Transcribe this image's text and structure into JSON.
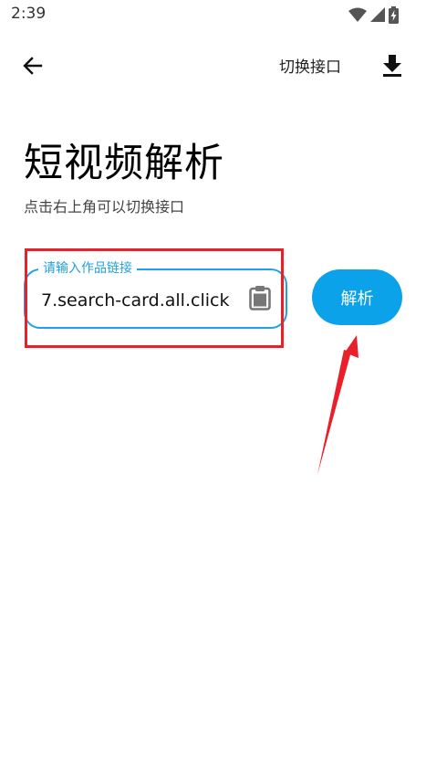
{
  "status_bar": {
    "time": "2:39",
    "icons": [
      "wifi-icon",
      "signal-icon",
      "battery-charging-icon"
    ]
  },
  "app_bar": {
    "back_icon": "arrow-left-icon",
    "switch_api_label": "切换接口",
    "download_icon": "download-icon"
  },
  "header": {
    "title": "短视频解析",
    "subtitle": "点击右上角可以切换接口"
  },
  "link_input": {
    "label": "请输入作品链接",
    "value": "7.search-card.all.click",
    "paste_icon": "clipboard-icon"
  },
  "parse_button": {
    "label": "解析"
  },
  "colors": {
    "accent": "#1ea1e6",
    "button": "#0ba2ea",
    "annotation": "#e8202a"
  }
}
